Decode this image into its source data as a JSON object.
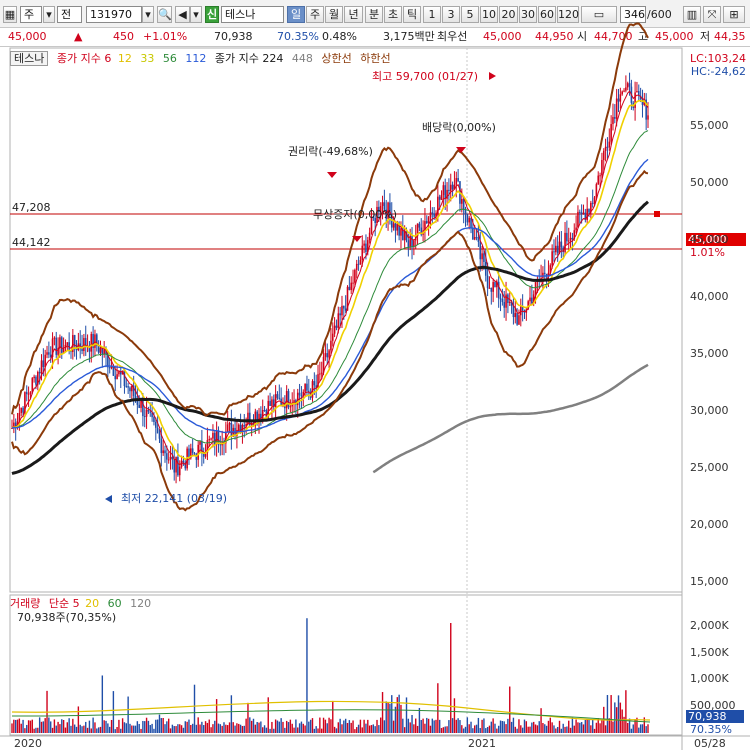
{
  "toolbar": {
    "market_select": "주",
    "type_label": "전",
    "code": "131970",
    "badge": "신",
    "stock_name": "테스나",
    "periods": [
      "일",
      "주",
      "월",
      "년",
      "분",
      "초",
      "틱",
      "1",
      "3",
      "5",
      "10",
      "20",
      "30",
      "60",
      "120"
    ],
    "active_period": "일",
    "count": "346",
    "count_total": "/600"
  },
  "quote": {
    "price": "45,000",
    "change": "450",
    "change_pct": "+1.01%",
    "volume": "70,938",
    "vol_ratio": "70.35%",
    "turnover": "0.48%",
    "amount": "3,175백만",
    "best_label": "최우선",
    "best_ask": "45,000",
    "best_bid": "44,950",
    "open_label": "시",
    "open": "44,700",
    "high_label": "고",
    "high": "45,000",
    "low_label": "저",
    "low": "44,35"
  },
  "legend": {
    "name": "테스나",
    "ma_label": "종가 지수 6",
    "ma12": "12",
    "ma33": "33",
    "ma56": "56",
    "ma112": "112",
    "ma2_label": "종가 지수 224",
    "ma448": "448",
    "upper": "상한선",
    "lower": "하한선"
  },
  "lc": {
    "lc": "LC:103,24",
    "hc": "HC:-24,62"
  },
  "annotations": {
    "high": "최고 59,700 (01/27)",
    "low": "최저 22,141 (03/19)",
    "rights": "권리락(-49,68%)",
    "free_issue": "무상증자(0,00%)",
    "dividend": "배당락(0,00%)"
  },
  "price_lines": {
    "line1": "47,208",
    "line2": "44,142",
    "current_tag": "45,000",
    "current_pct": "1.01%"
  },
  "y_axis_price": [
    "55,000",
    "50,000",
    "45,000",
    "40,000",
    "35,000",
    "30,000",
    "25,000",
    "20,000",
    "15,000"
  ],
  "volume": {
    "title": "거래량",
    "simple": "단순 5",
    "ma20": "20",
    "ma60": "60",
    "ma120": "120",
    "current": "70,938주(70,35%)",
    "y_axis": [
      "2,000K",
      "1,500K",
      "1,000K",
      "500,000"
    ],
    "tag": "70,938",
    "tag_pct": "70.35%"
  },
  "x_axis": {
    "start": "2020",
    "mid": "2021",
    "end": "05/28"
  },
  "colors": {
    "up": "#d0021b",
    "down": "#1f4ea8",
    "ma6": "#d0021b",
    "ma12": "#f0d000",
    "ma33": "#2e8b3a",
    "ma56": "#2a5ad8",
    "ma112": "#1a1a1a",
    "ma224": "#808080",
    "band": "#8b3a0a"
  }
}
